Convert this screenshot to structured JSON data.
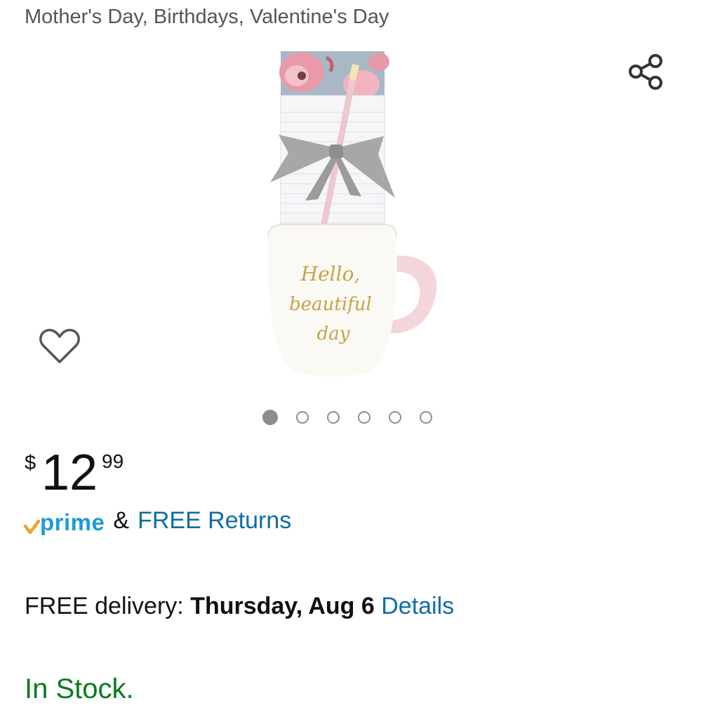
{
  "header": {
    "subtitle": "Mother's Day, Birthdays, Valentine's Day"
  },
  "product_image": {
    "mug_text_line1": "Hello,",
    "mug_text_line2": "beautiful",
    "mug_text_line3": "day",
    "image_count": 6,
    "active_index": 0
  },
  "icons": {
    "share": "share-icon",
    "wishlist": "heart-icon"
  },
  "price": {
    "currency": "$",
    "whole": "12",
    "fraction": "99"
  },
  "prime": {
    "logo_text": "prime",
    "amp": "&",
    "free_returns": "FREE Returns"
  },
  "delivery": {
    "label": "FREE delivery: ",
    "date": "Thursday, Aug 6",
    "details_link": "Details"
  },
  "stock": {
    "status": "In Stock."
  },
  "colors": {
    "link": "#0f6da5",
    "prime_blue": "#1d9bd6",
    "prime_check": "#f0a22b",
    "in_stock": "#0a7a1e"
  }
}
